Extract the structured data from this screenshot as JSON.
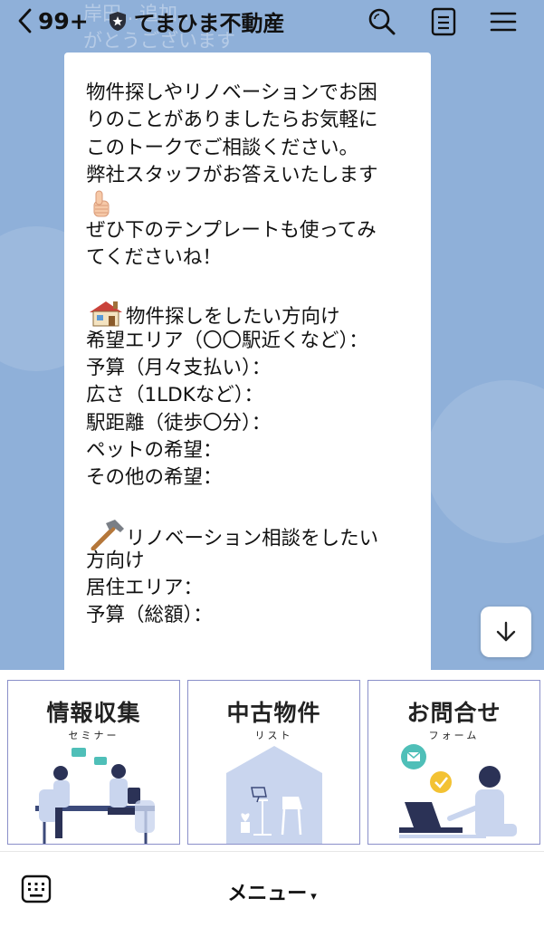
{
  "header": {
    "unread_count": "99+",
    "title": "てまひま不動産",
    "icons": [
      "back-chevron-icon",
      "official-shield-icon",
      "search-icon",
      "notes-icon",
      "menu-icon"
    ]
  },
  "background": {
    "partial_previous_message": "岸田...追加...\nがとうございます"
  },
  "message": {
    "lines": [
      "物件探しやリノベーションでお困",
      "りのことがありましたらお気軽に",
      "このトークでご相談ください。",
      "弊社スタッフがお答えいたします",
      "",
      "ぜひ下のテンプレートも使ってみ",
      "てくださいね！",
      "",
      "物件探しをしたい方向け",
      "希望エリア（〇〇駅近くなど）：",
      "予算（月々支払い）：",
      "広さ（1LDKなど）：",
      "駅距離（徒歩〇分）：",
      "ペットの希望：",
      "その他の希望：",
      "",
      "リノベーション相談をしたい",
      "方向け",
      "居住エリア：",
      "予算（総額）："
    ],
    "emojis": [
      "thumbs-up-icon",
      "house-icon",
      "hammer-icon"
    ]
  },
  "rich_menu": {
    "tiles": [
      {
        "title": "情報収集",
        "subtitle": "セミナー"
      },
      {
        "title": "中古物件",
        "subtitle": "リスト"
      },
      {
        "title": "お問合せ",
        "subtitle": "フォーム"
      }
    ]
  },
  "bottom_bar": {
    "menu_label": "メニュー",
    "caret": "▾"
  },
  "colors": {
    "chat_background": "#8fb0d9",
    "tile_border": "#8a8fc9",
    "illustration_blue": "#c9d5ee",
    "accent_teal": "#4fbfb8",
    "accent_yellow": "#f3c233"
  }
}
